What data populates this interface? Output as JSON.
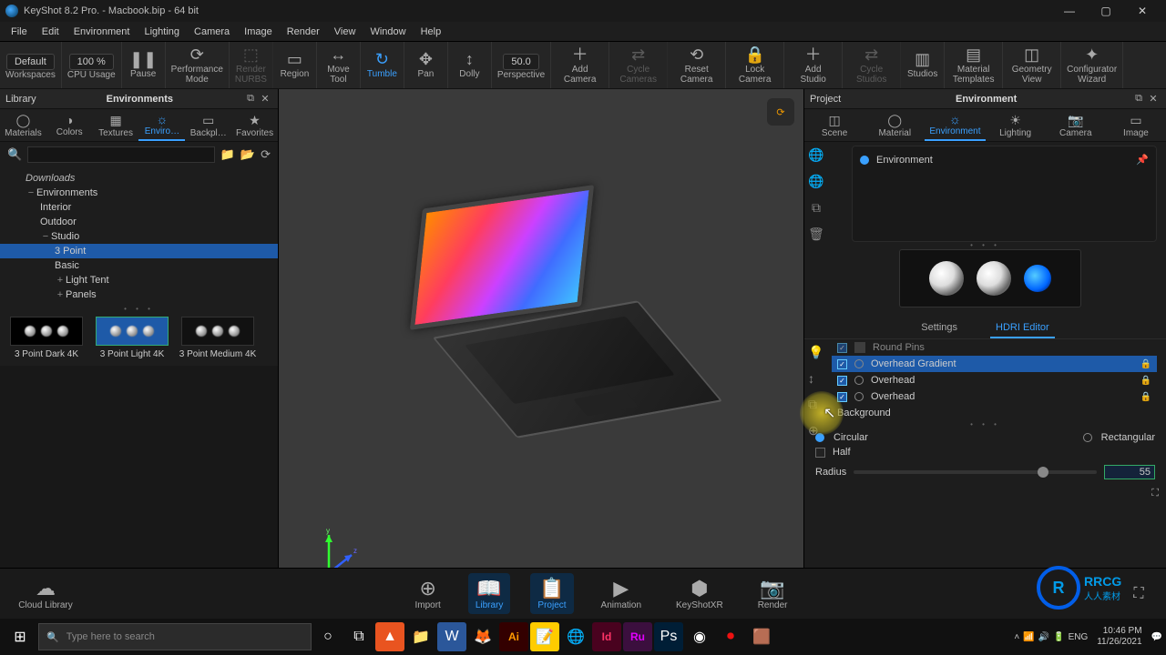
{
  "titlebar": {
    "title": "KeyShot 8.2 Pro. - Macbook.bip  - 64 bit"
  },
  "menubar": [
    "File",
    "Edit",
    "Environment",
    "Lighting",
    "Camera",
    "Image",
    "Render",
    "View",
    "Window",
    "Help"
  ],
  "ribbon": {
    "preset": "Default",
    "zoom": "100 %",
    "items": [
      {
        "label": "Workspaces",
        "icon": "▦"
      },
      {
        "label": "CPU Usage",
        "icon": "◉"
      },
      {
        "label": "Pause",
        "icon": "❚❚"
      },
      {
        "label": "Performance\nMode",
        "icon": "⟳"
      },
      {
        "label": "Render\nNURBS",
        "icon": "⬚",
        "dim": true
      },
      {
        "label": "Region",
        "icon": "▭"
      },
      {
        "label": "Move\nTool",
        "icon": "↔"
      },
      {
        "label": "Tumble",
        "icon": "↻",
        "sel": true
      },
      {
        "label": "Pan",
        "icon": "✥"
      },
      {
        "label": "Dolly",
        "icon": "↕"
      },
      {
        "label": "Perspective",
        "icon": "50.0"
      },
      {
        "label": "Add\nCamera",
        "icon": "＋"
      },
      {
        "label": "Cycle\nCameras",
        "icon": "⇄",
        "dim": true
      },
      {
        "label": "Reset\nCamera",
        "icon": "⟲"
      },
      {
        "label": "Lock\nCamera",
        "icon": "🔒"
      },
      {
        "label": "Add\nStudio",
        "icon": "＋"
      },
      {
        "label": "Cycle\nStudios",
        "icon": "⇄",
        "dim": true
      },
      {
        "label": "Studios",
        "icon": "▥"
      },
      {
        "label": "Material\nTemplates",
        "icon": "▤"
      },
      {
        "label": "Geometry\nView",
        "icon": "◫"
      },
      {
        "label": "Configurator\nWizard",
        "icon": "✦"
      }
    ]
  },
  "library": {
    "panel_left": "Library",
    "panel_center": "Environments",
    "tabs": [
      {
        "label": "Materials",
        "icon": "◯"
      },
      {
        "label": "Colors",
        "icon": "◑"
      },
      {
        "label": "Textures",
        "icon": "▦"
      },
      {
        "label": "Enviro…",
        "icon": "☼",
        "sel": true
      },
      {
        "label": "Backpl…",
        "icon": "▭"
      },
      {
        "label": "Favorites",
        "icon": "★"
      }
    ],
    "search_placeholder": "",
    "tree": [
      {
        "label": "Downloads",
        "lvl": 0,
        "head": true
      },
      {
        "label": "Environments",
        "lvl": 0,
        "exp": true
      },
      {
        "label": "Interior",
        "lvl": 1
      },
      {
        "label": "Outdoor",
        "lvl": 1
      },
      {
        "label": "Studio",
        "lvl": 1,
        "exp": true
      },
      {
        "label": "3 Point",
        "lvl": 2,
        "sel": true
      },
      {
        "label": "Basic",
        "lvl": 2
      },
      {
        "label": "Light Tent",
        "lvl": 2,
        "plus": true
      },
      {
        "label": "Panels",
        "lvl": 2,
        "plus": true
      }
    ],
    "thumbs": [
      {
        "cap": "3 Point Dark 4K"
      },
      {
        "cap": "3 Point Light 4K",
        "sel": true
      },
      {
        "cap": "3 Point Medium 4K"
      }
    ]
  },
  "project": {
    "panel_left": "Project",
    "panel_center": "Environment",
    "tabs": [
      {
        "label": "Scene",
        "icon": "◫"
      },
      {
        "label": "Material",
        "icon": "◯"
      },
      {
        "label": "Environment",
        "icon": "☼",
        "sel": true
      },
      {
        "label": "Lighting",
        "icon": "☀"
      },
      {
        "label": "Camera",
        "icon": "📷"
      },
      {
        "label": "Image",
        "icon": "▭"
      }
    ],
    "env_item": "Environment",
    "subtabs": {
      "settings": "Settings",
      "hdri": "HDRI Editor"
    },
    "pins_header": "Round Pins",
    "pins": [
      {
        "label": "Overhead Gradient",
        "sel": true
      },
      {
        "label": "Overhead"
      },
      {
        "label": "Overhead"
      }
    ],
    "background": "Background",
    "shape": {
      "circular": "Circular",
      "rectangular": "Rectangular",
      "half": "Half"
    },
    "radius_label": "Radius",
    "radius_value": "55"
  },
  "dock": {
    "cloud": "Cloud Library",
    "tabs": [
      {
        "label": "Import",
        "icon": "⬇"
      },
      {
        "label": "Library",
        "icon": "📖",
        "sel": true
      },
      {
        "label": "Project",
        "icon": "📋",
        "sel": true
      },
      {
        "label": "Animation",
        "icon": "▶"
      },
      {
        "label": "KeyShotXR",
        "icon": "◯"
      },
      {
        "label": "Render",
        "icon": "📷"
      }
    ]
  },
  "taskbar": {
    "search_placeholder": "Type here to search",
    "lang": "ENG",
    "time": "10:46 PM",
    "date": "11/26/2021"
  },
  "watermark": {
    "brand": "RRCG",
    "sub": "人人素材"
  }
}
